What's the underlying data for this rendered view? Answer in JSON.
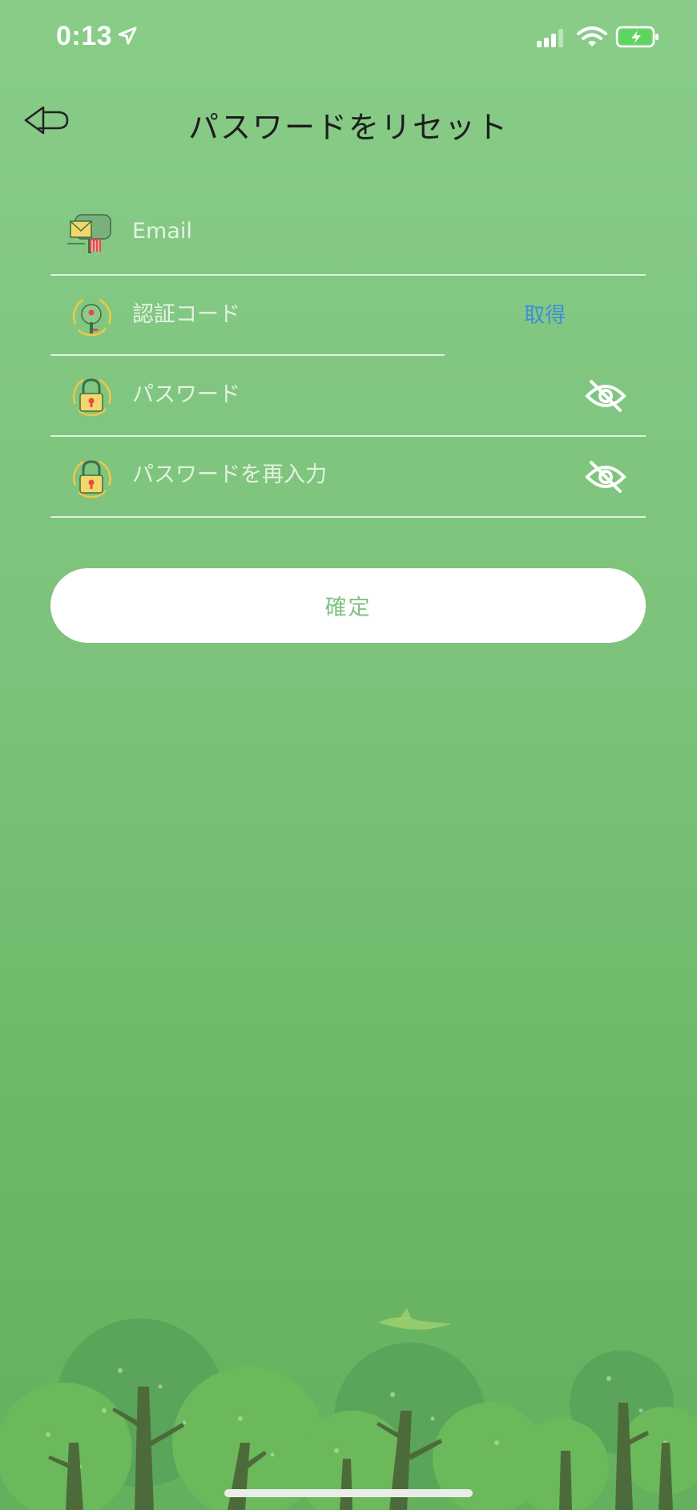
{
  "status_bar": {
    "time": "0:13"
  },
  "header": {
    "title": "パスワードをリセット"
  },
  "form": {
    "email": {
      "placeholder": "Email",
      "value": ""
    },
    "verification_code": {
      "placeholder": "認証コード",
      "value": "",
      "get_code_label": "取得"
    },
    "password": {
      "placeholder": "パスワード",
      "value": ""
    },
    "password_confirm": {
      "placeholder": "パスワードを再入力",
      "value": ""
    }
  },
  "confirm_button": {
    "label": "確定"
  },
  "icons": {
    "back": "back-arrow-icon",
    "email": "mailbox-icon",
    "code": "key-badge-icon",
    "password": "padlock-icon",
    "eye": "eye-slash-icon"
  },
  "colors": {
    "background_top": "#88cc88",
    "background_bottom": "#64b05e",
    "accent_link": "#3f8fd6",
    "button_text": "#7fc17f"
  }
}
